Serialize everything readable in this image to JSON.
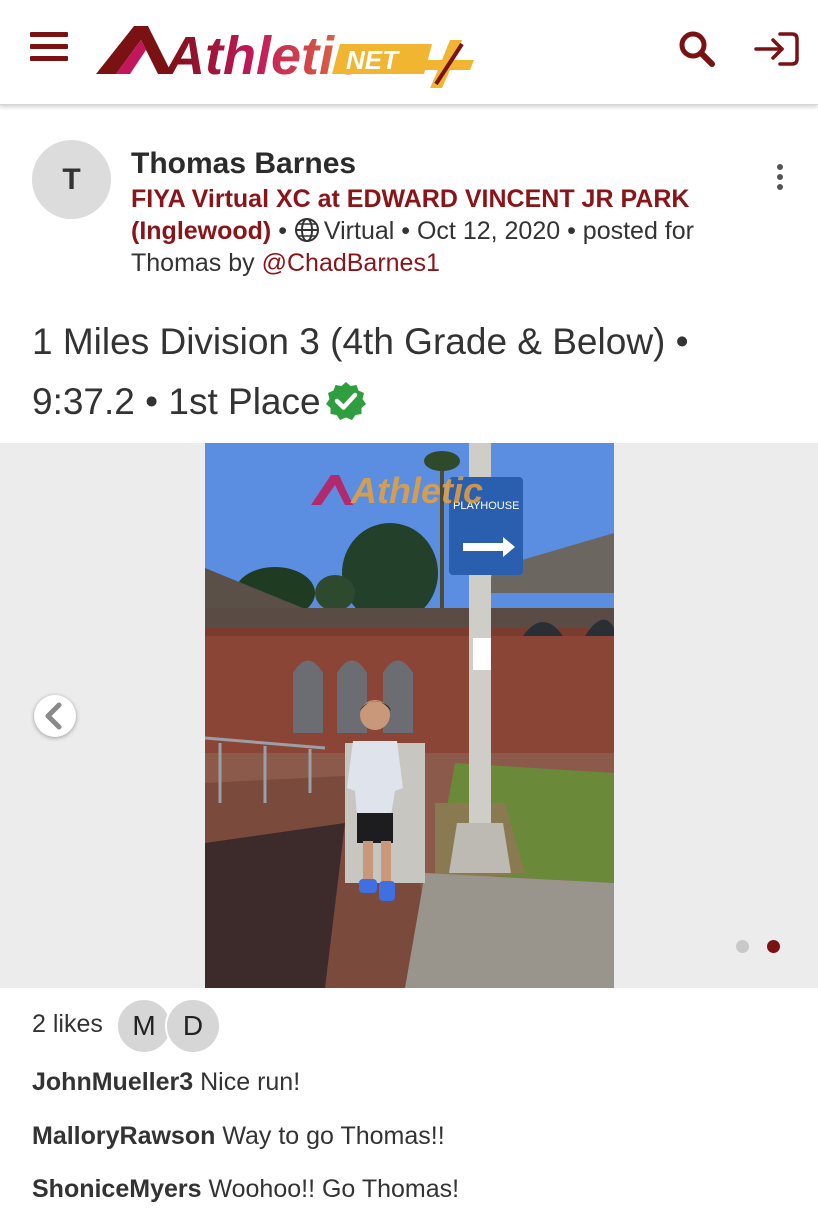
{
  "header": {
    "logo_text": "Athletic",
    "logo_badge": "NET",
    "menu_icon": "hamburger-icon",
    "search_icon": "search-icon",
    "login_icon": "sign-in-icon",
    "brand_colors": {
      "maroon": "#7a1113",
      "pink": "#c2185b",
      "gold": "#f2b531"
    }
  },
  "post": {
    "avatar_initial": "T",
    "author": "Thomas Barnes",
    "meeting": "FIYA Virtual XC at EDWARD VINCENT JR PARK (Inglewood)",
    "sep1": " • ",
    "venue": "Virtual",
    "sep2": " • ",
    "date": "Oct 12, 2020",
    "sep3": " • ",
    "posted_for": "posted for Thomas by ",
    "poster": "@ChadBarnes1",
    "options_icon": "kebab-menu-icon"
  },
  "result": {
    "event": "1 Miles Division 3 (4th Grade & Below)",
    "sep1": " • ",
    "time": "9:37.2",
    "sep2": " • ",
    "place": "1st Place",
    "verified_icon": "verified-check-icon",
    "verified_color": "#2e9e3e"
  },
  "carousel": {
    "watermark": "Athletic",
    "sign_text": "PLAYHOUSE",
    "prev_icon": "chevron-left-icon",
    "total_slides": 2,
    "active_slide": 2
  },
  "likes": {
    "label": "2 likes",
    "likers": [
      "M",
      "D"
    ]
  },
  "comments": [
    {
      "user": "JohnMueller3",
      "text": "Nice run!"
    },
    {
      "user": "MalloryRawson",
      "text": "Way to go Thomas!!"
    },
    {
      "user": "ShoniceMyers",
      "text": "Woohoo!! Go Thomas!"
    }
  ]
}
